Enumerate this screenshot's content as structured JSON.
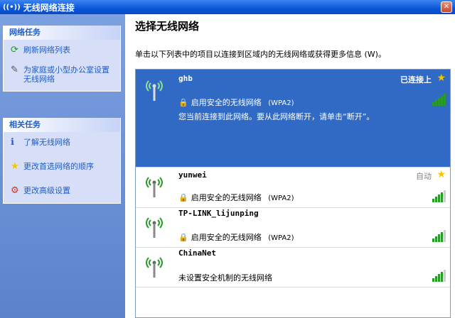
{
  "window": {
    "title": "无线网络连接"
  },
  "sidebar": {
    "network_tasks": {
      "header": "网络任务",
      "items": [
        {
          "label": "刷新网络列表",
          "icon": "refresh-icon"
        },
        {
          "label": "为家庭或小型办公室设置无线网络",
          "icon": "setup-icon"
        }
      ]
    },
    "related_tasks": {
      "header": "相关任务",
      "items": [
        {
          "label": "了解无线网络",
          "icon": "info-icon"
        },
        {
          "label": "更改首选网络的顺序",
          "icon": "star-icon"
        },
        {
          "label": "更改高级设置",
          "icon": "settings-icon"
        }
      ]
    }
  },
  "main": {
    "title": "选择无线网络",
    "instructions": "单击以下列表中的项目以连接到区域内的无线网络或获得更多信息 (W)。"
  },
  "networks": [
    {
      "ssid": "ghb",
      "status": "已连接上",
      "security": "启用安全的无线网络",
      "protocol": "(WPA2)",
      "description": "您当前连接到此网络。要从此网络断开，请单击“断开”。",
      "signal_bars": 5,
      "selected": true,
      "secured": true
    },
    {
      "ssid": "yunwei",
      "status": "自动",
      "security": "启用安全的无线网络",
      "protocol": "(WPA2)",
      "signal_bars": 4,
      "selected": false,
      "secured": true
    },
    {
      "ssid": "TP-LINK_lijunping",
      "security": "启用安全的无线网络",
      "protocol": "(WPA2)",
      "signal_bars": 4,
      "selected": false,
      "secured": true
    },
    {
      "ssid": "ChinaNet",
      "security": "未设置安全机制的无线网络",
      "signal_bars": 4,
      "selected": false,
      "secured": false
    }
  ],
  "colors": {
    "selection": "#316ac5",
    "link": "#215dc6",
    "signal": "#2a9a2a",
    "star": "#f5c400"
  }
}
